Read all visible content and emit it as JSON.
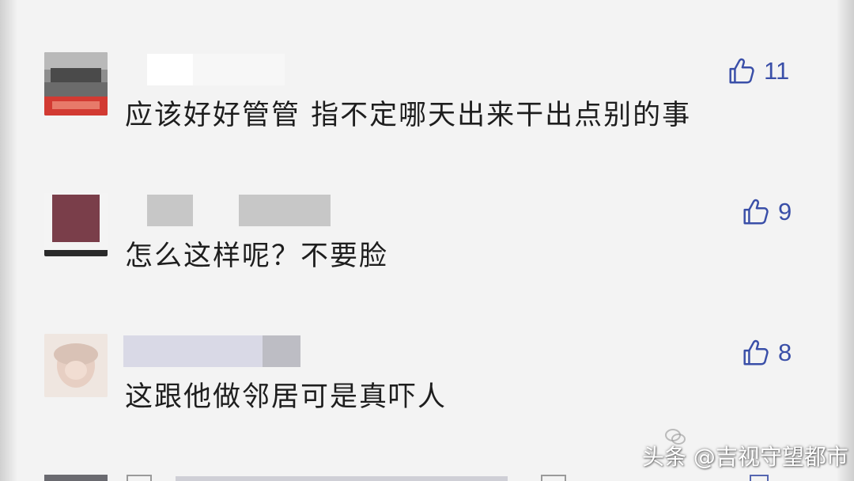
{
  "colors": {
    "background": "#f3f3f3",
    "like_accent": "#3a4fa8",
    "comment_text": "#1e1e1e",
    "name_redaction": "#c7c7c7"
  },
  "icons": {
    "like": "thumbs-up-outline-icon",
    "watermark_logo": "wechat-bubbles-icon"
  },
  "comments": [
    {
      "text": "应该好好管管 指不定哪天出来干出点别的事",
      "likes": "11"
    },
    {
      "text": "怎么这样呢？不要脸",
      "likes": "9"
    },
    {
      "text": "这跟他做邻居可是真吓人",
      "likes": "8"
    }
  ],
  "watermark": {
    "text": "头条 @吉视守望都市"
  }
}
